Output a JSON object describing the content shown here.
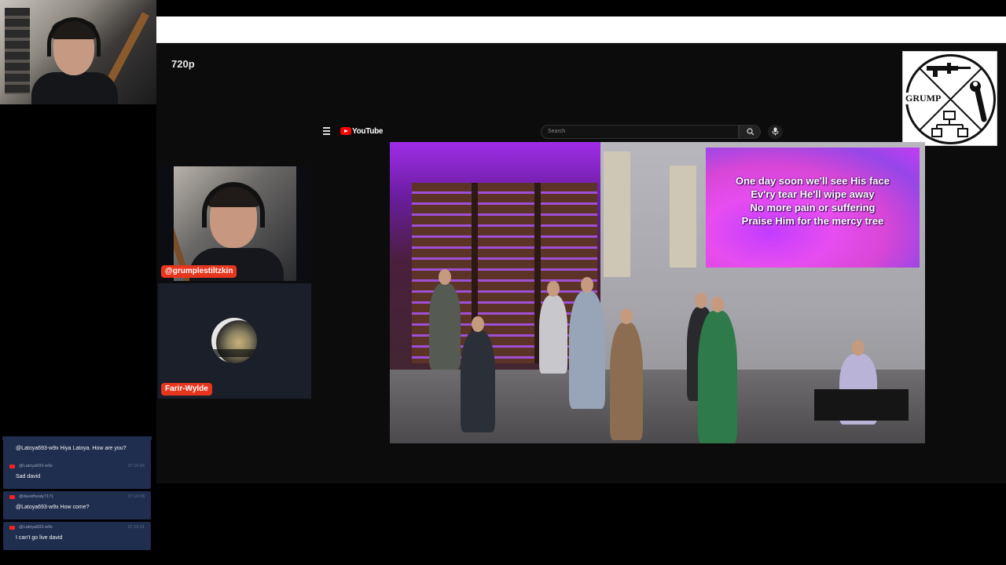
{
  "stream": {
    "quality_label": "720p"
  },
  "logo": {
    "text": "GRUMP",
    "icon": "grump-logo-rifle-wrench-network"
  },
  "participants": [
    {
      "name": "@grumplestiltzkin",
      "type": "webcam"
    },
    {
      "name": "Farir-Wylde",
      "type": "avatar"
    }
  ],
  "youtube": {
    "brand": "YouTube",
    "search_placeholder": "Search",
    "icons": [
      "menu-icon",
      "youtube-logo-icon",
      "search-icon",
      "mic-icon"
    ]
  },
  "video": {
    "lyrics": [
      "One day soon we'll see His face",
      "Ev'ry tear He'll wipe away",
      "No more pain or suffering",
      "Praise Him for the mercy tree"
    ]
  },
  "chat": {
    "messages": [
      {
        "user": "",
        "time": "",
        "text": "@Latoya693-w9x Hiya Latoya. How are you?"
      },
      {
        "user": "@Latoya693-w9x",
        "time": "07:16:54",
        "text": "Sad david"
      },
      {
        "user": "@davidhealy7171",
        "time": "07:19:08",
        "text": "@Latoya693-w9x How come?"
      },
      {
        "user": "@Latoya693-w9x",
        "time": "07:19:31",
        "text": "I can't go live david"
      }
    ]
  },
  "colors": {
    "name_tag": "#e8361e",
    "chat_bubble": "#1f2e4f",
    "youtube_red": "#ff0000",
    "lyrics_bg": "#d846d6"
  }
}
